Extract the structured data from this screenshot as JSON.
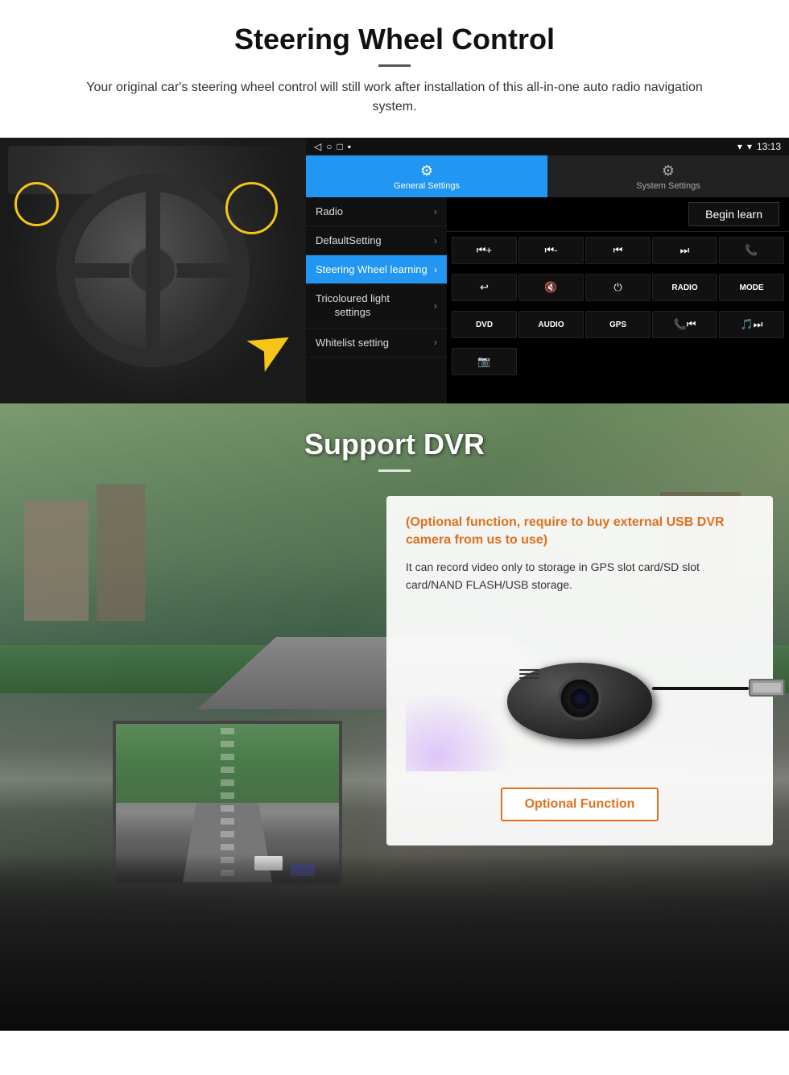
{
  "page": {
    "section1": {
      "title": "Steering Wheel Control",
      "subtitle": "Your original car's steering wheel control will still work after installation of this all-in-one auto radio navigation system.",
      "statusbar": {
        "time": "13:13",
        "icons": [
          "signal",
          "wifi",
          "battery"
        ]
      },
      "head_unit": {
        "tab_active": "General Settings",
        "tab_inactive": "System Settings",
        "tab_active_icon": "⚙",
        "tab_inactive_icon": "🔗",
        "menu_items": [
          {
            "label": "Radio",
            "active": false
          },
          {
            "label": "DefaultSetting",
            "active": false
          },
          {
            "label": "Steering Wheel learning",
            "active": true
          },
          {
            "label": "Tricoloured light settings",
            "active": false
          },
          {
            "label": "Whitelist setting",
            "active": false
          }
        ],
        "begin_learn_label": "Begin learn",
        "buttons_row1": [
          "⏮+",
          "⏮-",
          "⏮",
          "⏭",
          "📞"
        ],
        "buttons_row2": [
          "↩",
          "🔇x",
          "⏻",
          "RADIO",
          "MODE"
        ],
        "buttons_row3": [
          "DVD",
          "AUDIO",
          "GPS",
          "📞⏮",
          "🎵⏭"
        ],
        "buttons_row4": [
          "📷"
        ]
      }
    },
    "section2": {
      "title": "Support DVR",
      "info_title": "(Optional function, require to buy external USB DVR camera from us to use)",
      "info_text": "It can record video only to storage in GPS slot card/SD slot card/NAND FLASH/USB storage.",
      "optional_function_label": "Optional Function"
    }
  }
}
